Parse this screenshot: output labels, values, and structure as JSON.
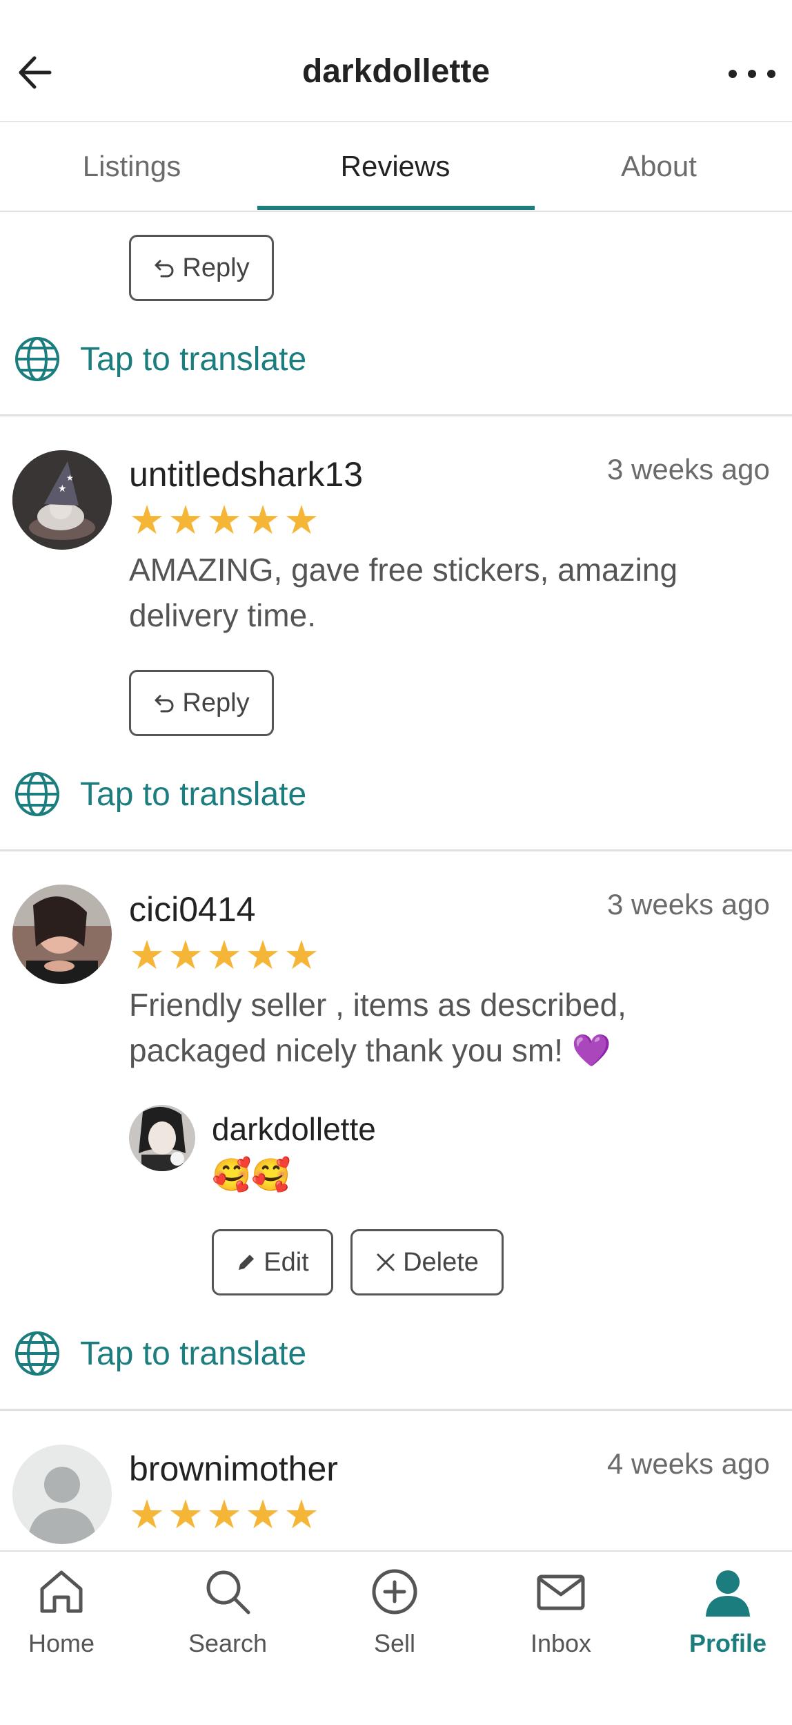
{
  "header": {
    "title": "darkdollette"
  },
  "tabs": [
    {
      "label": "Listings"
    },
    {
      "label": "Reviews",
      "active": true
    },
    {
      "label": "About"
    }
  ],
  "common": {
    "reply_label": "Reply",
    "translate_label": "Tap to translate",
    "edit_label": "Edit",
    "delete_label": "Delete"
  },
  "reviews": [
    {
      "user": "untitledshark13",
      "time": "3 weeks ago",
      "rating": 5,
      "text_line1": "AMAZING, gave free stickers, amazing",
      "text_line2": "delivery time."
    },
    {
      "user": "cici0414",
      "time": "3 weeks ago",
      "rating": 5,
      "text_line1": "Friendly seller , items as described,",
      "text_line2": "packaged nicely thank you sm! 💜",
      "seller_reply": {
        "user": "darkdollette",
        "text": "🥰🥰"
      }
    },
    {
      "user": "brownimother",
      "time": "4 weeks ago",
      "rating": 5
    }
  ],
  "nav": [
    {
      "label": "Home",
      "icon": "home-icon"
    },
    {
      "label": "Search",
      "icon": "search-icon"
    },
    {
      "label": "Sell",
      "icon": "plus-circle-icon"
    },
    {
      "label": "Inbox",
      "icon": "mail-icon"
    },
    {
      "label": "Profile",
      "icon": "profile-icon",
      "active": true
    }
  ],
  "colors": {
    "accent": "#1b7d7d",
    "star": "#f5b638",
    "divider": "#e0e0e0"
  }
}
